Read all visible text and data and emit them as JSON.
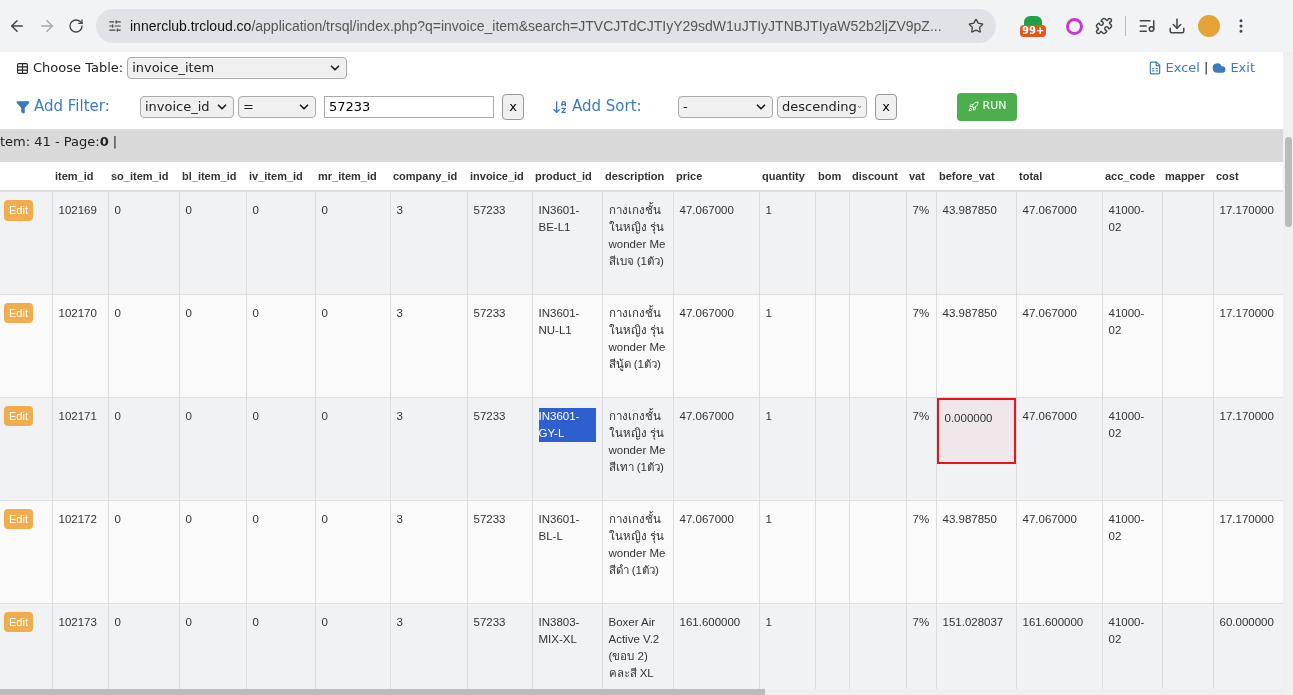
{
  "browser": {
    "url_host": "innerclub.trcloud.co",
    "url_path": "/application/trsql/index.php?q=invoice_item&search=JTVCJTdCJTIyY29sdW1uJTIyJTNBJTIyaW52b2ljZV9pZ...",
    "extension_badge": "99+"
  },
  "toolbar": {
    "choose_label": "Choose Table:",
    "table_select": "invoice_item",
    "excel_link": "Excel",
    "separator": "|",
    "exit_link": "Exit"
  },
  "filter": {
    "label": "Add Filter:",
    "field": "invoice_id",
    "operator": "=",
    "value": "57233",
    "clear": "x"
  },
  "sort": {
    "label": "Add Sort:",
    "field": "-",
    "direction": "descending",
    "clear": "x"
  },
  "run_button": "RUN",
  "summary": "tem: 41 - Page:**0** |",
  "table": {
    "columns": [
      "",
      "item_id",
      "so_item_id",
      "bl_item_id",
      "iv_item_id",
      "mr_item_id",
      "company_id",
      "invoice_id",
      "product_id",
      "description",
      "price",
      "quantity",
      "bom",
      "discount",
      "vat",
      "before_vat",
      "total",
      "acc_code",
      "mapper",
      "cost"
    ],
    "rows": [
      {
        "product_selected": false,
        "before_vat_flagged": false,
        "cells": [
          "Edit",
          "102169",
          "0",
          "0",
          "0",
          "0",
          "3",
          "57233",
          "IN3601-BE-L1",
          "กางเกงชั้นในหญิง รุ่น wonder Me สีเบจ (1ตัว)",
          "47.067000",
          "1",
          "",
          "",
          "7%",
          "43.987850",
          "47.067000",
          "41000-02",
          "",
          "17.170000"
        ]
      },
      {
        "product_selected": false,
        "before_vat_flagged": false,
        "cells": [
          "Edit",
          "102170",
          "0",
          "0",
          "0",
          "0",
          "3",
          "57233",
          "IN3601-NU-L1",
          "กางเกงชั้นในหญิง รุ่น wonder Me สีนู้ด (1ตัว)",
          "47.067000",
          "1",
          "",
          "",
          "7%",
          "43.987850",
          "47.067000",
          "41000-02",
          "",
          "17.170000"
        ]
      },
      {
        "product_selected": true,
        "before_vat_flagged": true,
        "cells": [
          "Edit",
          "102171",
          "0",
          "0",
          "0",
          "0",
          "3",
          "57233",
          "IN3601-GY-L",
          "กางเกงชั้นในหญิง รุ่น wonder Me สีเทา (1ตัว)",
          "47.067000",
          "1",
          "",
          "",
          "7%",
          "0.000000",
          "47.067000",
          "41000-02",
          "",
          "17.170000"
        ]
      },
      {
        "product_selected": false,
        "before_vat_flagged": false,
        "cells": [
          "Edit",
          "102172",
          "0",
          "0",
          "0",
          "0",
          "3",
          "57233",
          "IN3601-BL-L",
          "กางเกงชั้นในหญิง รุ่น wonder Me สีดำ (1ตัว)",
          "47.067000",
          "1",
          "",
          "",
          "7%",
          "43.987850",
          "47.067000",
          "41000-02",
          "",
          "17.170000"
        ]
      },
      {
        "product_selected": false,
        "before_vat_flagged": false,
        "cells": [
          "Edit",
          "102173",
          "0",
          "0",
          "0",
          "0",
          "3",
          "57233",
          "IN3803-MIX-XL",
          "Boxer Air Active V.2 (ขอบ 2) คละสี XL",
          "161.600000",
          "1",
          "",
          "",
          "7%",
          "151.028037",
          "161.600000",
          "41000-02",
          "",
          "60.000000"
        ]
      }
    ]
  }
}
